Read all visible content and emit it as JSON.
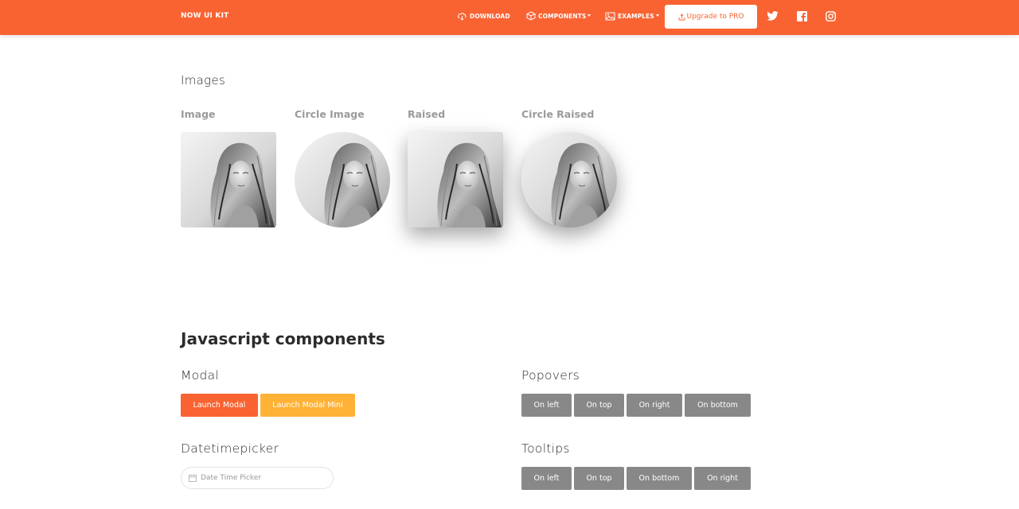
{
  "navbar": {
    "brand": "NOW UI KIT",
    "download": "DOWNLOAD",
    "components": "COMPONENTS",
    "examples": "EXAMPLES",
    "upgrade": "Upgrade to PRO",
    "accent": "#f96332"
  },
  "images_section": {
    "title": "Images",
    "items": [
      {
        "label": "Image",
        "style": "rounded"
      },
      {
        "label": "Circle Image",
        "style": "circle"
      },
      {
        "label": "Raised",
        "style": "rounded-raised"
      },
      {
        "label": "Circle Raised",
        "style": "circle-raised"
      }
    ]
  },
  "js_section": {
    "title": "Javascript components",
    "modal": {
      "title": "Modal",
      "launch": "Launch Modal",
      "launch_mini": "Launch Modal Mini"
    },
    "popovers": {
      "title": "Popovers",
      "buttons": [
        "On left",
        "On top",
        "On right",
        "On bottom"
      ]
    },
    "datetimepicker": {
      "title": "Datetimepicker",
      "placeholder": "Date Time Picker"
    },
    "tooltips": {
      "title": "Tooltips",
      "buttons": [
        "On left",
        "On top",
        "On bottom",
        "On right"
      ]
    }
  },
  "colors": {
    "primary": "#f96332",
    "warning": "#ffb236",
    "default": "#888888"
  }
}
